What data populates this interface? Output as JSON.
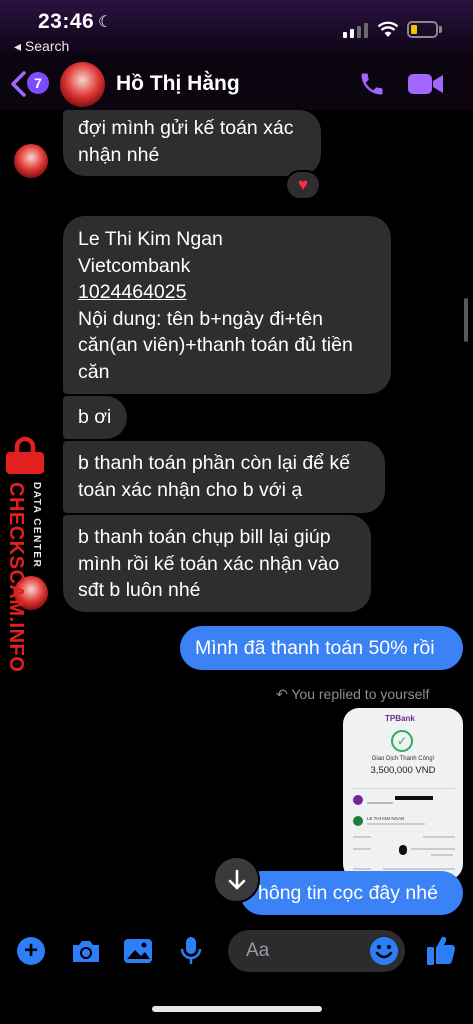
{
  "status": {
    "time": "23:46",
    "back_label": "Search"
  },
  "header": {
    "unread_count": "7",
    "contact_name": "Hồ Thị Hằng"
  },
  "messages": {
    "m1_line1": "đợi mình gửi kế toán xác",
    "m1_line2": "nhận nhé",
    "m2_line1": "Le Thi Kim Ngan",
    "m2_line2": "Vietcombank",
    "m2_line3": "1024464025",
    "m2_line4": "Nội dung: tên b+ngày đi+tên",
    "m2_line5": "căn(an viên)+thanh toán đủ tiền",
    "m2_line6": "căn",
    "m3": "b ơi",
    "m4_line1": "b thanh toán phần còn lại để kế",
    "m4_line2": "toán xác nhận cho b với ạ",
    "m5_line1": "b thanh toán chụp bill lại giúp",
    "m5_line2": "mình rồi kế toán xác nhận vào",
    "m5_line3": "sđt b luôn nhé",
    "out1": "Mình đã thanh toán 50% rồi",
    "replied_label": "You replied to yourself",
    "out2": "hông tin cọc đây nhé"
  },
  "receipt": {
    "bank": "TPBank",
    "title": "Giao Dịch Thành Công!",
    "amount": "3,500,000 VND",
    "recipient": "LE THI KIM NGAN"
  },
  "watermark": {
    "line1": "DATA CENTER",
    "line2": "CHECKSCAM.INFO"
  },
  "composer": {
    "placeholder": "Aa"
  },
  "colors": {
    "accent": "#7b4dff",
    "outgoing": "#3b82f6",
    "incoming": "#2e2e30",
    "reaction": "heart"
  }
}
